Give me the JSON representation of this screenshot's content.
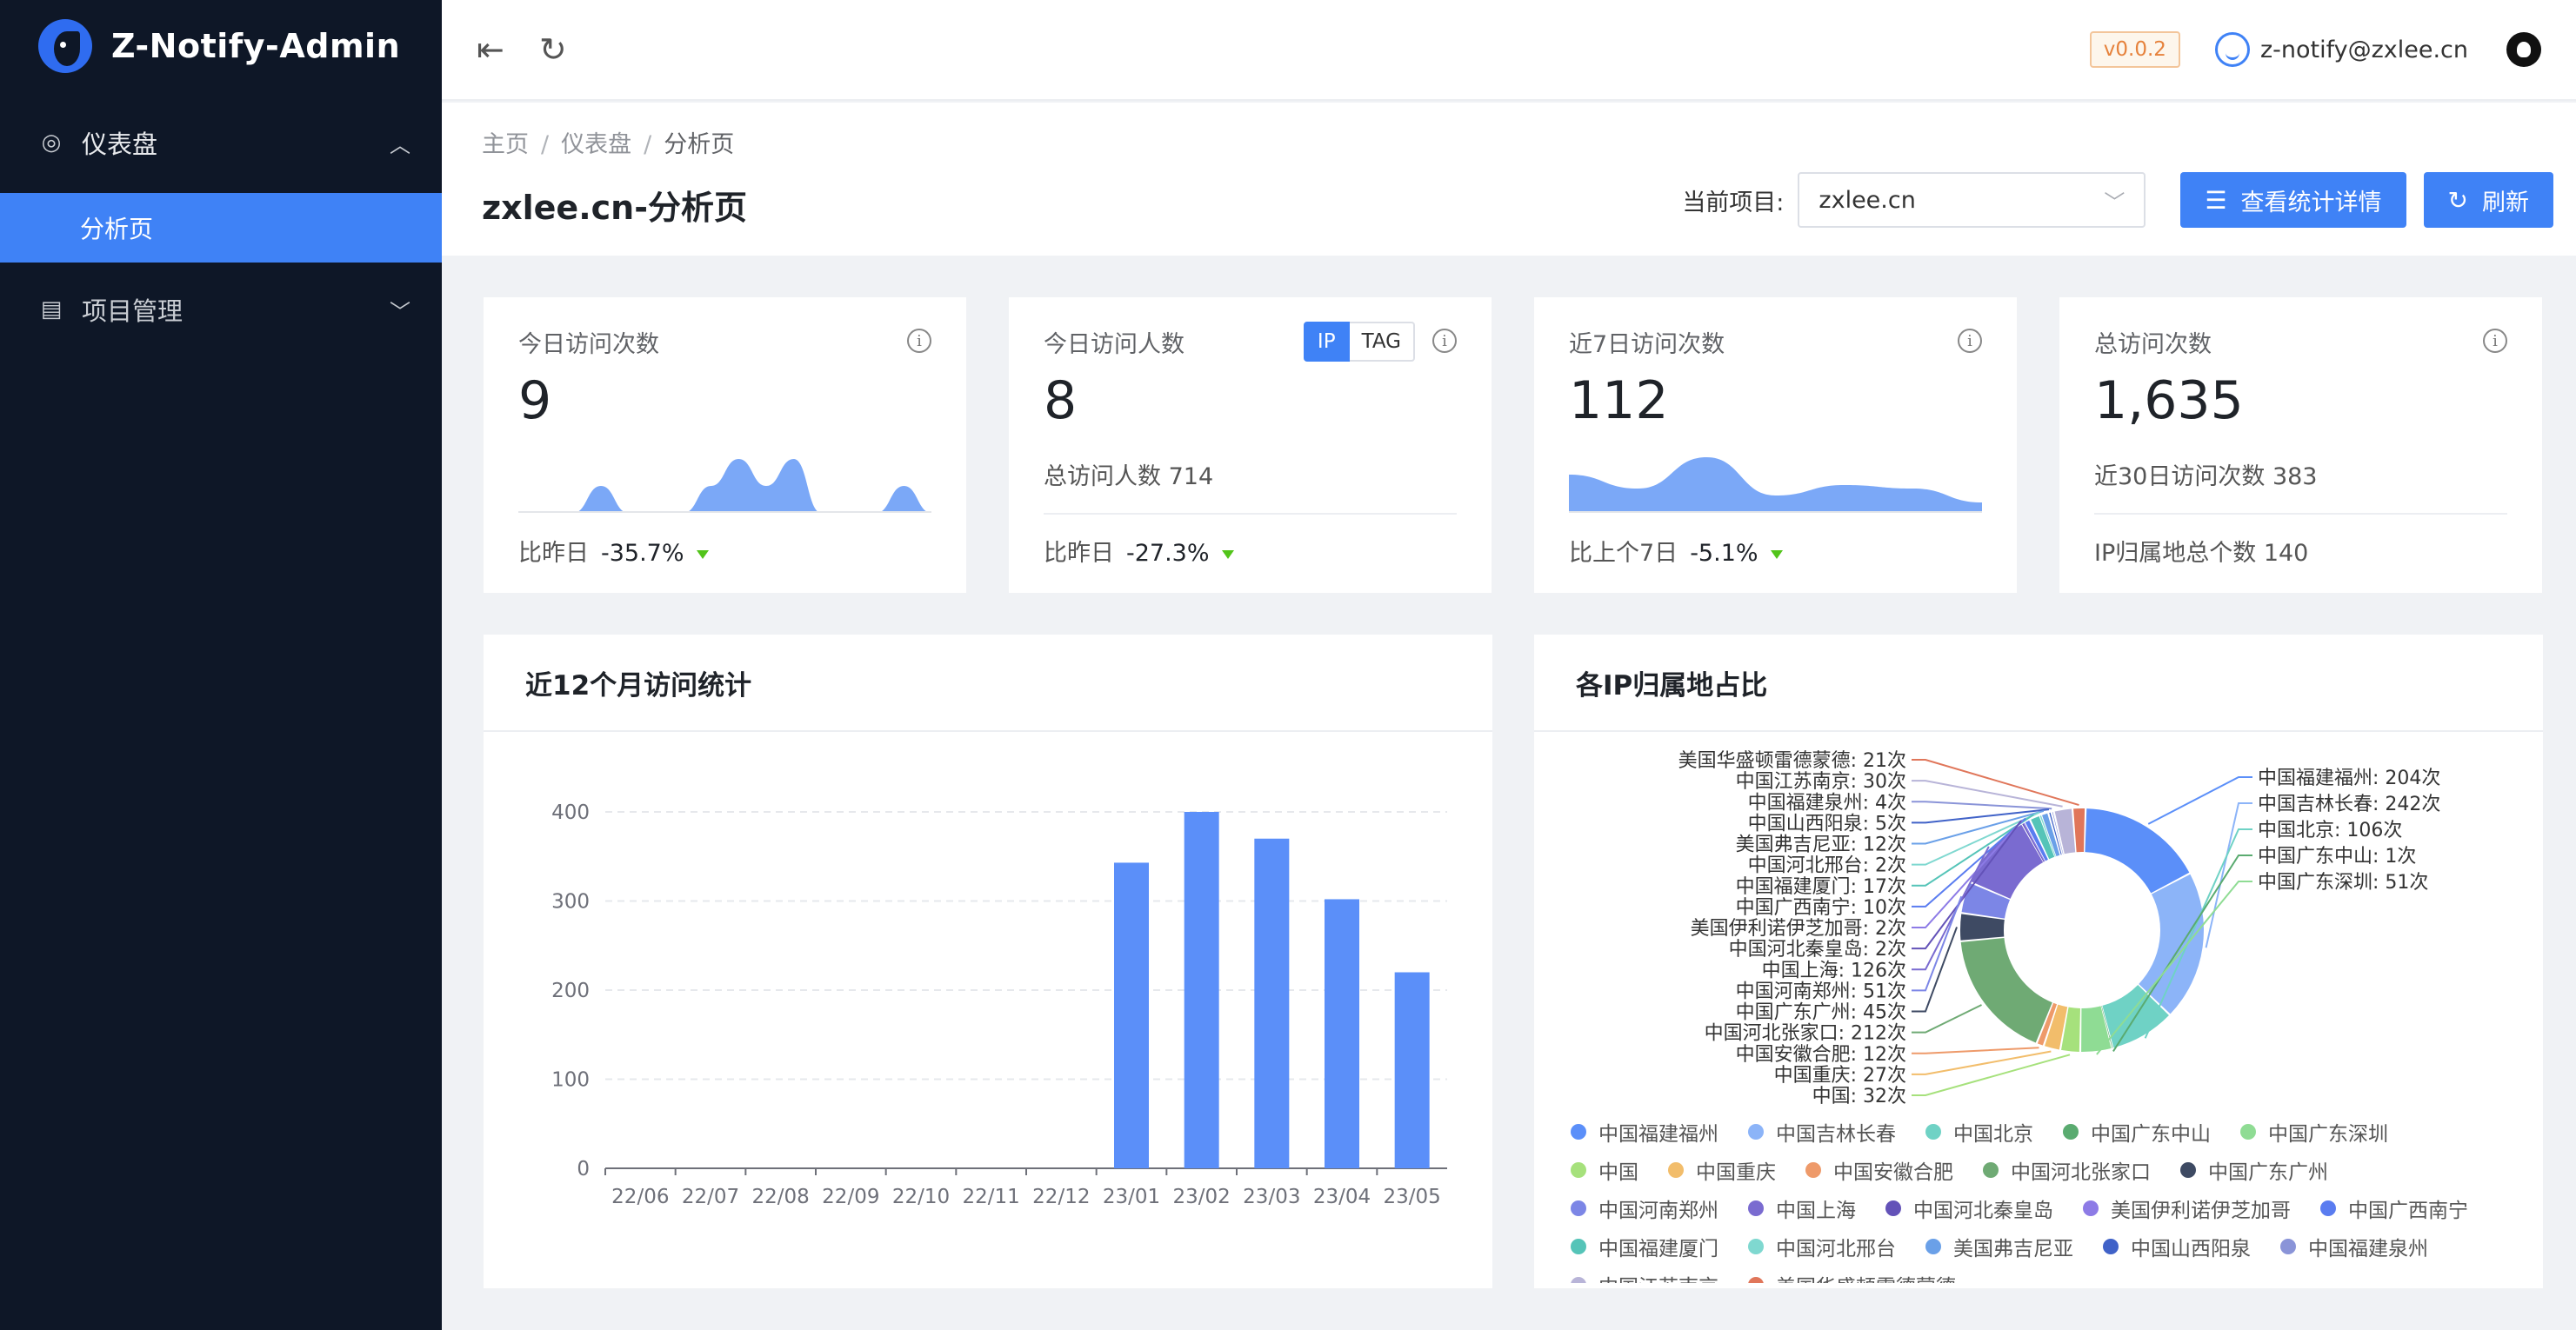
{
  "app": {
    "title": "Z-Notify-Admin",
    "version": "v0.0.2",
    "user": "z-notify@zxlee.cn"
  },
  "sidebar": {
    "group1": {
      "label": "仪表盘",
      "child": "分析页"
    },
    "group2": {
      "label": "项目管理"
    }
  },
  "breadcrumb": [
    "主页",
    "仪表盘",
    "分析页"
  ],
  "page": {
    "title": "zxlee.cn-分析页",
    "project_label": "当前项目:",
    "project_value": "zxlee.cn",
    "details_btn": "查看统计详情",
    "refresh_btn": "刷新"
  },
  "stats": {
    "today_visits": {
      "title": "今日访问次数",
      "value": "9",
      "foot_label": "比昨日",
      "foot_value": "-35.7%"
    },
    "today_visitors": {
      "title": "今日访问人数",
      "value": "8",
      "sub": "总访问人数 714",
      "foot_label": "比昨日",
      "foot_value": "-27.3%",
      "seg_ip": "IP",
      "seg_tag": "TAG"
    },
    "week_visits": {
      "title": "近7日访问次数",
      "value": "112",
      "foot_label": "比上个7日",
      "foot_value": "-5.1%"
    },
    "total_visits": {
      "title": "总访问次数",
      "value": "1,635",
      "sub": "近30日访问次数 383",
      "foot": "IP归属地总个数 140"
    }
  },
  "colors": {
    "primary": "#3f82f6",
    "sidebar": "#0e1727",
    "down": "#52c41a"
  },
  "chart_data": [
    {
      "type": "area",
      "values": [
        0,
        0,
        0,
        2,
        0,
        0,
        0,
        2,
        4,
        2,
        4,
        0,
        0,
        0,
        2,
        0
      ],
      "title": "",
      "xlabel": "",
      "ylabel": ""
    },
    {
      "type": "area",
      "values": [
        22,
        14,
        32,
        10,
        16,
        14,
        6
      ],
      "title": "",
      "xlabel": "",
      "ylabel": ""
    },
    {
      "type": "bar",
      "title": "近12个月访问统计",
      "categories": [
        "22/06",
        "22/07",
        "22/08",
        "22/09",
        "22/10",
        "22/11",
        "22/12",
        "23/01",
        "23/02",
        "23/03",
        "23/04",
        "23/05"
      ],
      "values": [
        0,
        0,
        0,
        0,
        0,
        0,
        0,
        343,
        400,
        370,
        302,
        220
      ],
      "yticks": [
        0,
        100,
        200,
        300,
        400
      ],
      "ylim": [
        0,
        400
      ],
      "xlabel": "",
      "ylabel": "",
      "grid": true
    },
    {
      "type": "pie",
      "title": "各IP归属地占比",
      "slices": [
        {
          "name": "中国福建福州",
          "label": "中国福建福州: 204次",
          "value": 204,
          "color": "#5b8ff9"
        },
        {
          "name": "中国吉林长春",
          "label": "中国吉林长春: 242次",
          "value": 242,
          "color": "#8cb4f8"
        },
        {
          "name": "中国北京",
          "label": "中国北京: 106次",
          "value": 106,
          "color": "#6fd2c5"
        },
        {
          "name": "中国广东中山",
          "label": "中国广东中山: 1次",
          "value": 1,
          "color": "#5aab70"
        },
        {
          "name": "中国广东深圳",
          "label": "中国广东深圳: 51次",
          "value": 51,
          "color": "#8fdc94"
        },
        {
          "name": "中国",
          "label": "中国: 32次",
          "value": 32,
          "color": "#a6e17c"
        },
        {
          "name": "中国重庆",
          "label": "中国重庆: 27次",
          "value": 27,
          "color": "#f2bd6b"
        },
        {
          "name": "中国安徽合肥",
          "label": "中国安徽合肥: 12次",
          "value": 12,
          "color": "#ee9a6a"
        },
        {
          "name": "中国河北张家口",
          "label": "中国河北张家口: 212次",
          "value": 212,
          "color": "#6faa74"
        },
        {
          "name": "中国广东广州",
          "label": "中国广东广州: 45次",
          "value": 45,
          "color": "#3e4a63"
        },
        {
          "name": "中国河南郑州",
          "label": "中国河南郑州: 51次",
          "value": 51,
          "color": "#7c86e6"
        },
        {
          "name": "中国上海",
          "label": "中国上海: 126次",
          "value": 126,
          "color": "#7a6bd0"
        },
        {
          "name": "中国河北秦皇岛",
          "label": "中国河北秦皇岛: 2次",
          "value": 2,
          "color": "#6352b8"
        },
        {
          "name": "美国伊利诺伊芝加哥",
          "label": "美国伊利诺伊芝加哥: 2次",
          "value": 2,
          "color": "#8d7be6"
        },
        {
          "name": "中国广西南宁",
          "label": "中国广西南宁: 10次",
          "value": 10,
          "color": "#5a7cf0"
        },
        {
          "name": "中国福建厦门",
          "label": "中国福建厦门: 17次",
          "value": 17,
          "color": "#55c4b8"
        },
        {
          "name": "中国河北邢台",
          "label": "中国河北邢台: 2次",
          "value": 2,
          "color": "#7fd8d0"
        },
        {
          "name": "美国弗吉尼亚",
          "label": "美国弗吉尼亚: 12次",
          "value": 12,
          "color": "#6aa0e8"
        },
        {
          "name": "中国山西阳泉",
          "label": "中国山西阳泉: 5次",
          "value": 5,
          "color": "#4062c8"
        },
        {
          "name": "中国福建泉州",
          "label": "中国福建泉州: 4次",
          "value": 4,
          "color": "#8a94d8"
        },
        {
          "name": "中国江苏南京",
          "label": "中国江苏南京: 30次",
          "value": 30,
          "color": "#b8b4d8"
        },
        {
          "name": "美国华盛顿雷德蒙德",
          "label": "美国华盛顿雷德蒙德: 21次",
          "value": 21,
          "color": "#e0765a"
        }
      ]
    }
  ]
}
